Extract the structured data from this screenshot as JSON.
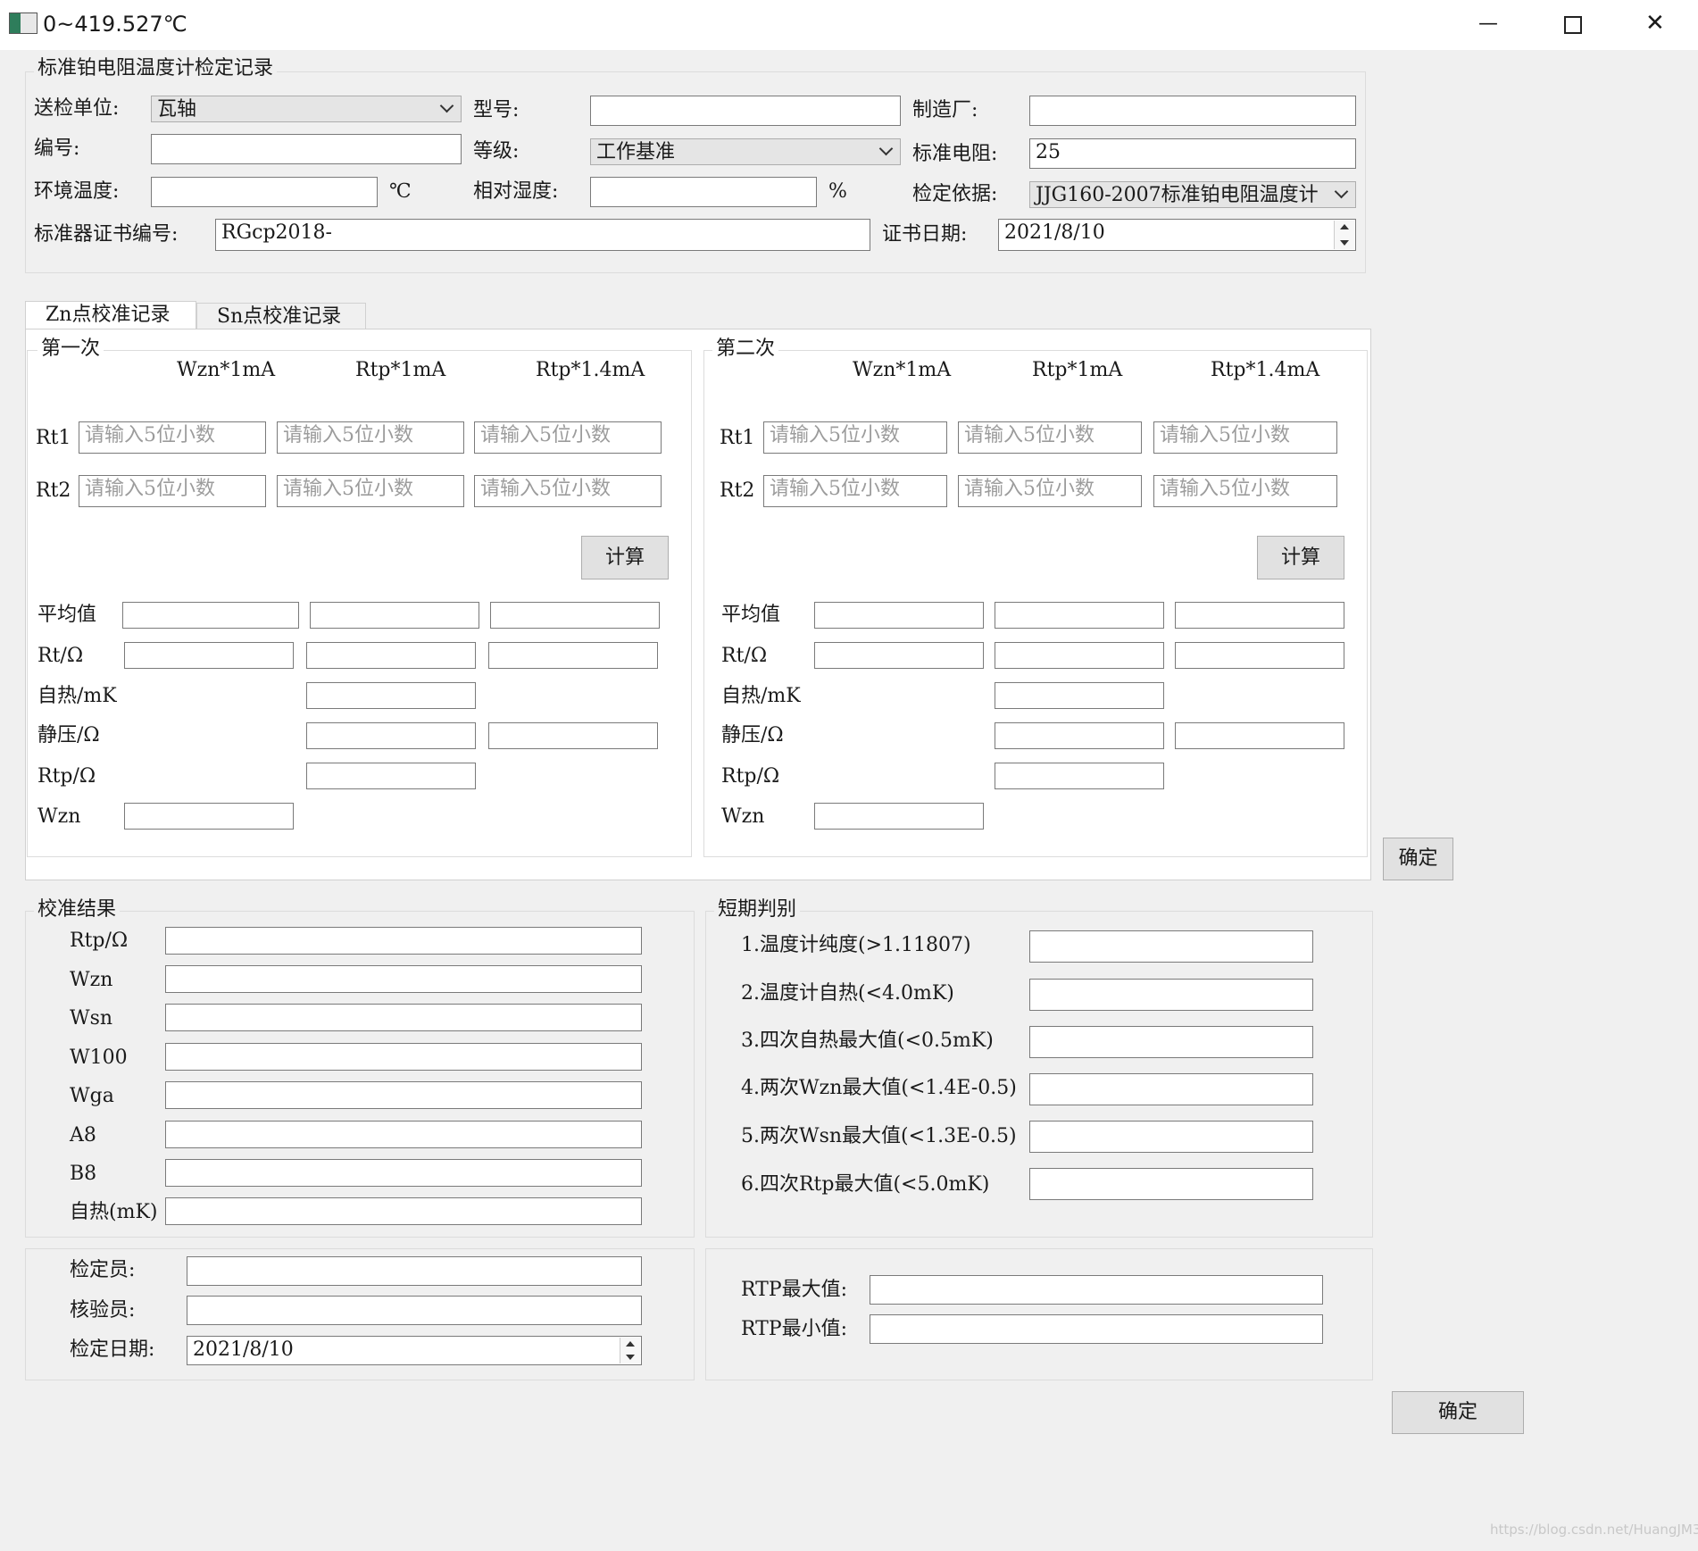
{
  "window": {
    "title": "0~419.527℃",
    "minimize_glyph": "—",
    "maximize_glyph": "☐",
    "close_glyph": "✕"
  },
  "header": {
    "title": "标准铂电阻温度计检定记录",
    "send_unit_label": "送检单位:",
    "send_unit_value": "瓦轴",
    "model_label": "型号:",
    "model_value": "",
    "maker_label": "制造厂:",
    "maker_value": "",
    "serial_label": "编号:",
    "serial_value": "",
    "grade_label": "等级:",
    "grade_value": "工作基准",
    "std_res_label": "标准电阻:",
    "std_res_value": "25",
    "env_temp_label": "环境温度:",
    "env_temp_value": "",
    "env_temp_unit": "℃",
    "humidity_label": "相对湿度:",
    "humidity_value": "",
    "humidity_unit": "%",
    "basis_label": "检定依据:",
    "basis_value": "JJG160-2007标准铂电阻温度计",
    "cert_no_label": "标准器证书编号:",
    "cert_no_value": "RGcp2018-",
    "cert_date_label": "证书日期:",
    "cert_date_value": "2021/8/10"
  },
  "tabs": [
    {
      "label": "Zn点校准记录",
      "active": true
    },
    {
      "label": "Sn点校准记录",
      "active": false
    }
  ],
  "calibration": {
    "columns": [
      "Wzn*1mA",
      "Rtp*1mA",
      "Rtp*1.4mA"
    ],
    "rows": [
      "Rt1",
      "Rt2"
    ],
    "placeholder": "请输入5位小数",
    "calc_label": "计算",
    "result_labels": {
      "avg": "平均值",
      "rt": "Rt/Ω",
      "self_heat": "自热/mK",
      "static_pressure": "静压/Ω",
      "rtp": "Rtp/Ω",
      "wzn": "Wzn"
    },
    "first_title": "第一次",
    "second_title": "第二次",
    "confirm_label": "确定"
  },
  "results": {
    "title": "校准结果",
    "items": [
      {
        "label": "Rtp/Ω",
        "value": ""
      },
      {
        "label": "Wzn",
        "value": ""
      },
      {
        "label": "Wsn",
        "value": ""
      },
      {
        "label": "W100",
        "value": ""
      },
      {
        "label": "Wga",
        "value": ""
      },
      {
        "label": "A8",
        "value": ""
      },
      {
        "label": "B8",
        "value": ""
      },
      {
        "label": "自热(mK)",
        "value": ""
      }
    ]
  },
  "shortterm": {
    "title": "短期判别",
    "items": [
      {
        "label": "1.温度计纯度(>1.11807)",
        "value": ""
      },
      {
        "label": "2.温度计自热(<4.0mK)",
        "value": ""
      },
      {
        "label": "3.四次自热最大值(<0.5mK)",
        "value": ""
      },
      {
        "label": "4.两次Wzn最大值(<1.4E-0.5)",
        "value": ""
      },
      {
        "label": "5.两次Wsn最大值(<1.3E-0.5)",
        "value": ""
      },
      {
        "label": "6.四次Rtp最大值(<5.0mK)",
        "value": ""
      }
    ]
  },
  "footer": {
    "verifier_label": "检定员:",
    "verifier_value": "",
    "checker_label": "核验员:",
    "checker_value": "",
    "date_label": "检定日期:",
    "date_value": "2021/8/10",
    "rtp_max_label": "RTP最大值:",
    "rtp_max_value": "",
    "rtp_min_label": "RTP最小值:",
    "rtp_min_value": "",
    "confirm_label": "确定"
  },
  "watermark": "https://blog.csdn.net/HuangJM3"
}
